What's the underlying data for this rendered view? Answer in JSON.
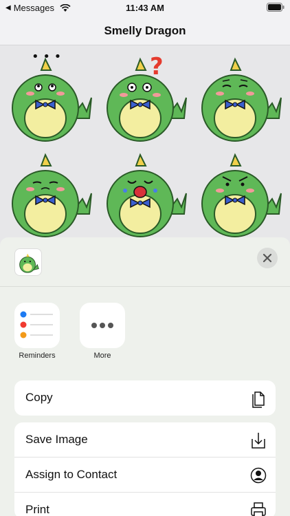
{
  "status_bar": {
    "back_app": "Messages",
    "time": "11:43 AM"
  },
  "nav": {
    "title": "Smelly Dragon"
  },
  "stickers": [
    {
      "name": "sticker-thinking",
      "dots": "• • •"
    },
    {
      "name": "sticker-confused",
      "mark": "?"
    },
    {
      "name": "sticker-worried"
    },
    {
      "name": "sticker-sad"
    },
    {
      "name": "sticker-crying"
    },
    {
      "name": "sticker-angry"
    }
  ],
  "share_sheet": {
    "apps": [
      {
        "label": "Reminders",
        "icon": "reminders-icon"
      },
      {
        "label": "More",
        "icon": "more-icon"
      }
    ],
    "actions_primary": [
      {
        "label": "Copy",
        "icon": "copy-icon"
      }
    ],
    "actions_secondary": [
      {
        "label": "Save Image",
        "icon": "download-icon"
      },
      {
        "label": "Assign to Contact",
        "icon": "contact-icon"
      },
      {
        "label": "Print",
        "icon": "printer-icon"
      }
    ]
  },
  "colors": {
    "dragon_green": "#5fb857",
    "belly": "#f3eea0",
    "bow_blue": "#3a5fcf",
    "accent_close": "#555555"
  }
}
